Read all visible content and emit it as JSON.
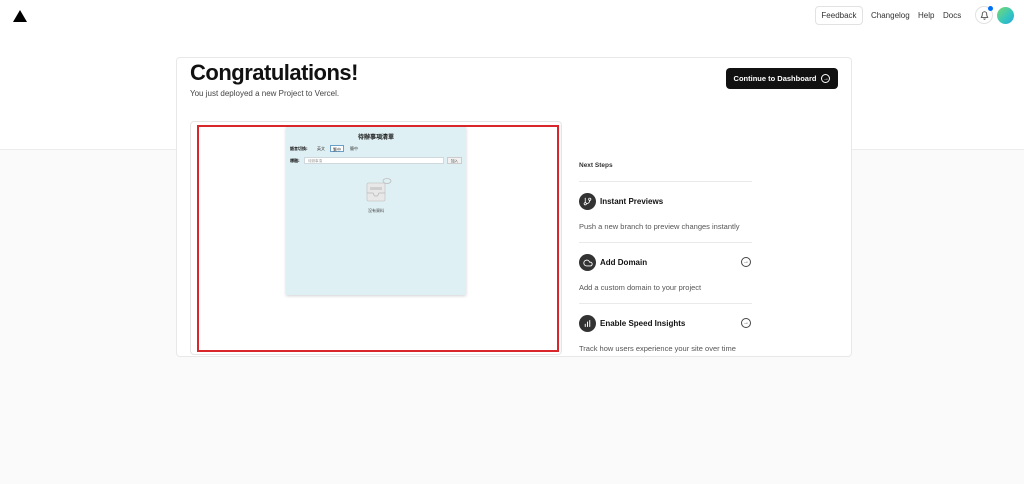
{
  "header": {
    "logo_icon": "vercel-triangle-icon",
    "feedback_label": "Feedback",
    "nav": [
      "Changelog",
      "Help",
      "Docs"
    ],
    "notification_icon": "bell-icon",
    "avatar_colors": [
      "#7bd86f",
      "#2aa6d8"
    ]
  },
  "main": {
    "title": "Congratulations!",
    "subtitle": "You just deployed a new Project to Vercel.",
    "dashboard_button": "Continue to Dashboard"
  },
  "preview": {
    "app_title": "待辦事項清單",
    "language_label": "語言切換:",
    "languages": [
      "英文",
      "繁中",
      "簡中"
    ],
    "active_language": "繁中",
    "field_label": "標題:",
    "field_placeholder": "待辦事項",
    "add_label": "加入",
    "empty_text": "沒有資料",
    "highlight_color": "#d9262b"
  },
  "next_steps": {
    "title": "Next Steps",
    "items": [
      {
        "title": "Instant Previews",
        "description": "Push a new branch to preview changes instantly",
        "icon": "git-branch-icon"
      },
      {
        "title": "Add Domain",
        "description": "Add a custom domain to your project",
        "icon": "cloud-icon"
      },
      {
        "title": "Enable Speed Insights",
        "description": "Track how users experience your site over time",
        "icon": "bar-chart-icon"
      }
    ]
  }
}
